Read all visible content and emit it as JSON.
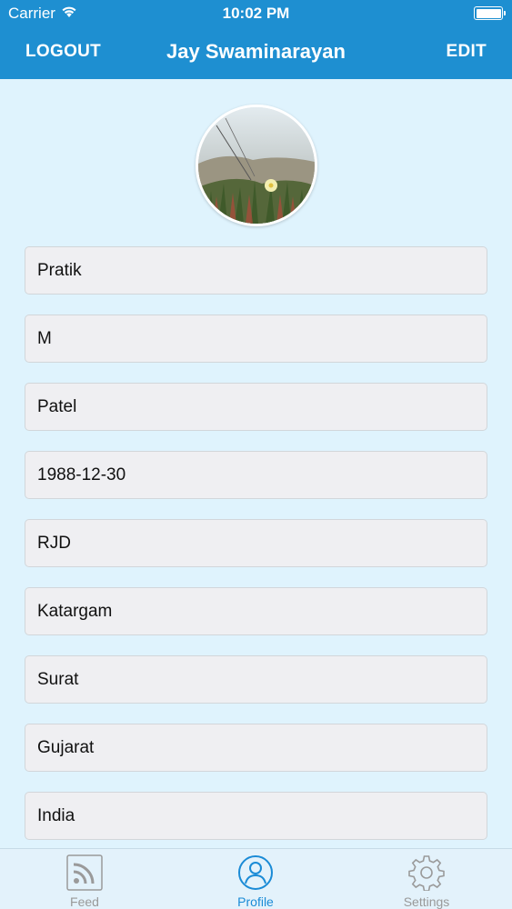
{
  "status_bar": {
    "carrier": "Carrier",
    "time": "10:02 PM",
    "wifi_icon": "wifi-icon",
    "battery_icon": "battery-icon"
  },
  "nav": {
    "left_label": "LOGOUT",
    "title": "Jay Swaminarayan",
    "right_label": "EDIT"
  },
  "profile": {
    "avatar_icon": "profile-photo",
    "fields": [
      "Pratik",
      "M",
      "Patel",
      "1988-12-30",
      "RJD",
      "Katargam",
      "Surat",
      "Gujarat",
      "India"
    ]
  },
  "tabbar": {
    "tabs": [
      {
        "label": "Feed",
        "icon": "rss-feed-icon",
        "active": false
      },
      {
        "label": "Profile",
        "icon": "user-circle-icon",
        "active": true
      },
      {
        "label": "Settings",
        "icon": "gear-icon",
        "active": false
      }
    ]
  },
  "colors": {
    "nav_bg": "#1e8fd1",
    "page_bg": "#dff3fd",
    "field_bg": "#efeff2",
    "active_tab": "#1a8bd6",
    "inactive_tab": "#999999"
  }
}
